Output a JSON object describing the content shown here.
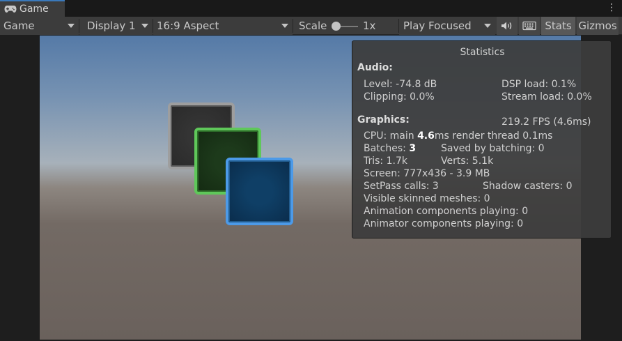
{
  "tab": {
    "label": "Game",
    "icon": "gamepad-icon"
  },
  "toolbar": {
    "display_mode": "Game",
    "display": "Display 1",
    "aspect": "16:9 Aspect",
    "scale_label": "Scale",
    "scale_value": "1x",
    "play_mode": "Play Focused",
    "stats_label": "Stats",
    "gizmos_label": "Gizmos"
  },
  "stats": {
    "title": "Statistics",
    "audio_header": "Audio:",
    "level": "Level: -74.8 dB",
    "dsp": "DSP load: 0.1%",
    "clipping": "Clipping: 0.0%",
    "stream": "Stream load: 0.0%",
    "graphics_header": "Graphics:",
    "fps": "219.2 FPS (4.6ms)",
    "cpu_prefix": "CPU: main ",
    "cpu_main": "4.6",
    "cpu_suffix": "ms  render thread 0.1ms",
    "batches_prefix": "Batches: ",
    "batches": "3",
    "saved": "Saved by batching: 0",
    "tris": "Tris: 1.7k",
    "verts": "Verts: 5.1k",
    "screen": "Screen: 777x436 - 3.9 MB",
    "setpass": "SetPass calls: 3",
    "shadow": "Shadow casters: 0",
    "skinned": "Visible skinned meshes: 0",
    "animation": "Animation components playing: 0",
    "animator": "Animator components playing: 0"
  },
  "colors": {
    "tab_accent": "#3a79bb",
    "square_gray_border": "#9e9e9e",
    "square_green_border": "#5fc85a",
    "square_blue_border": "#4c9ae8"
  }
}
